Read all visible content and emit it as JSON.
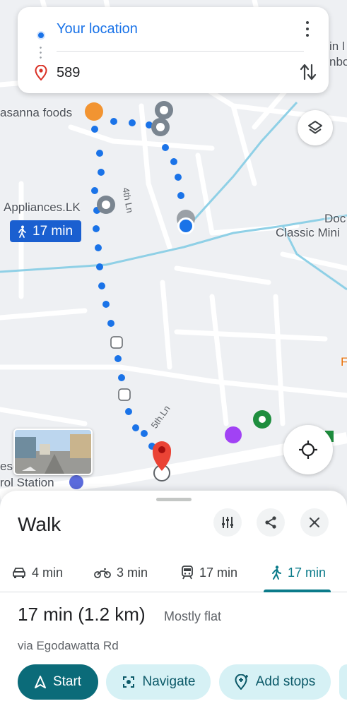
{
  "directions": {
    "origin": "Your location",
    "destination": "589",
    "more_icon": "more-vert-icon",
    "swap_icon": "swap-vert-icon"
  },
  "map": {
    "labels": {
      "asanna_foods": "asanna foods",
      "appliances": "Appliances.LK",
      "classic_mini": "Classic Mini",
      "doc": "Doc",
      "rol_station": "rol Station",
      "esg": "esg",
      "in_l": "in l",
      "nbo": "nbo",
      "f": "F"
    },
    "roads": {
      "fourth_ln": "4th Ln",
      "fifth_ln": "5th.Ln"
    },
    "walk_chip": "17 min",
    "route_color": "#1a73e8",
    "destination_color": "#ea4335"
  },
  "sheet": {
    "title": "Walk",
    "modes": [
      {
        "name": "car",
        "label": "4 min"
      },
      {
        "name": "motorbike",
        "label": "3 min"
      },
      {
        "name": "transit",
        "label": "17 min"
      },
      {
        "name": "walk",
        "label": "17 min",
        "active": true
      }
    ],
    "duration": "17 min (1.2 km)",
    "terrain": "Mostly flat",
    "via": "via Egodawatta Rd",
    "actions": {
      "start": "Start",
      "navigate": "Navigate",
      "add_stops": "Add stops"
    },
    "accent": "#0b7b8a"
  }
}
